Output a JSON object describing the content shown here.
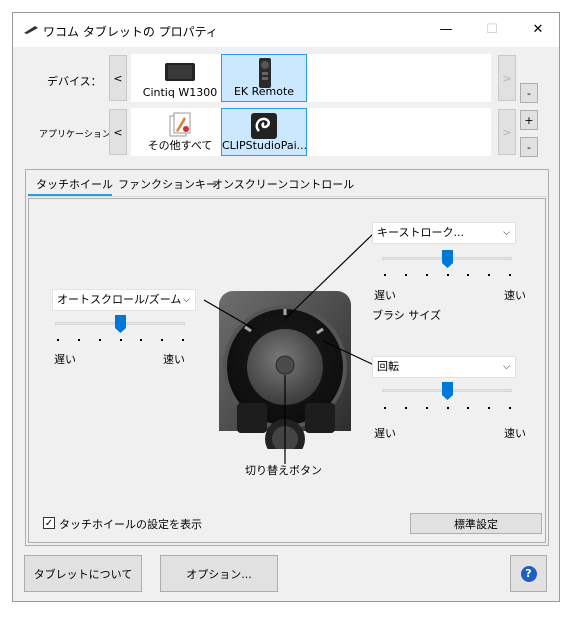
{
  "window": {
    "title": "ワコム タブレットの プロパティ",
    "minimize": "—",
    "maximize": "☐",
    "close": "✕"
  },
  "devices": {
    "label": "デバイス：",
    "prev": "<",
    "next": ">",
    "remove": "-",
    "items": [
      {
        "name": "Cintiq W1300",
        "icon": "tablet-icon",
        "selected": false
      },
      {
        "name": "EK Remote",
        "icon": "remote-icon",
        "selected": true
      }
    ]
  },
  "applications": {
    "label": "アプリケーション:",
    "prev": "<",
    "next": ">",
    "add": "+",
    "remove": "-",
    "items": [
      {
        "name": "その他すべて",
        "icon": "all-apps-icon",
        "selected": false
      },
      {
        "name": "CLIPStudioPai...",
        "icon": "clip-studio-icon",
        "selected": true
      }
    ]
  },
  "tabs": [
    "タッチホイール",
    "ファンクションキー",
    "オンスクリーンコントロール"
  ],
  "active_tab": 0,
  "left_control": {
    "value": "オートスクロール/ズーム",
    "slow": "遅い",
    "fast": "速い",
    "level": 0.5
  },
  "top_right_control": {
    "value": "キーストローク...",
    "slow": "遅い",
    "fast": "速い",
    "level": 0.5,
    "caption": "ブラシ サイズ"
  },
  "bottom_right_control": {
    "value": "回転",
    "slow": "遅い",
    "fast": "速い",
    "level": 0.5
  },
  "center_caption": "切り替えボタン",
  "show_settings_label": "タッチホイールの設定を表示",
  "show_settings_checked": true,
  "default_button": "標準設定",
  "about_button": "タブレットについて",
  "options_button": "オプション...",
  "help_icon": "?",
  "accent_color": "#26a0da",
  "slider_color": "#0078d7"
}
